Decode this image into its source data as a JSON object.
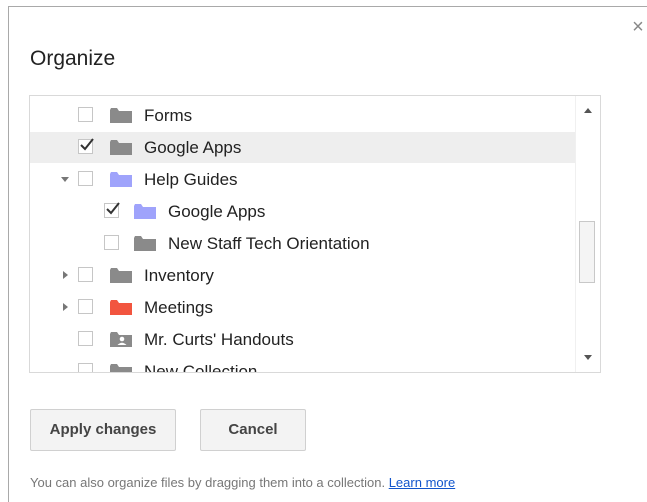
{
  "dialog": {
    "title": "Organize",
    "close_glyph": "×",
    "colors": {
      "gray_folder": "#8a8a8a",
      "purple_folder": "#9fa3fb",
      "red_folder": "#f2553f",
      "link": "#1155cc"
    }
  },
  "tree": {
    "items": [
      {
        "label": "Forms",
        "checked": false,
        "twisty": "none",
        "icon": "gray-folder-icon"
      },
      {
        "label": "Google Apps",
        "checked": true,
        "twisty": "none",
        "icon": "gray-folder-icon",
        "selected": true
      },
      {
        "label": "Help Guides",
        "checked": false,
        "twisty": "expanded",
        "icon": "purple-folder-icon"
      },
      {
        "label": "Google Apps",
        "checked": true,
        "twisty": "none",
        "icon": "purple-folder-icon"
      },
      {
        "label": "New Staff Tech Orientation",
        "checked": false,
        "twisty": "none",
        "icon": "gray-folder-icon"
      },
      {
        "label": "Inventory",
        "checked": false,
        "twisty": "collapsed",
        "icon": "gray-folder-icon"
      },
      {
        "label": "Meetings",
        "checked": false,
        "twisty": "collapsed",
        "icon": "red-folder-icon"
      },
      {
        "label": "Mr. Curts' Handouts",
        "checked": false,
        "twisty": "none",
        "icon": "shared-folder-icon"
      },
      {
        "label": "New Collection",
        "checked": false,
        "twisty": "none",
        "icon": "gray-folder-icon"
      }
    ]
  },
  "buttons": {
    "apply_label": "Apply changes",
    "cancel_label": "Cancel"
  },
  "footer": {
    "text": "You can also organize files by dragging them into a collection.",
    "link_text": "Learn more"
  }
}
